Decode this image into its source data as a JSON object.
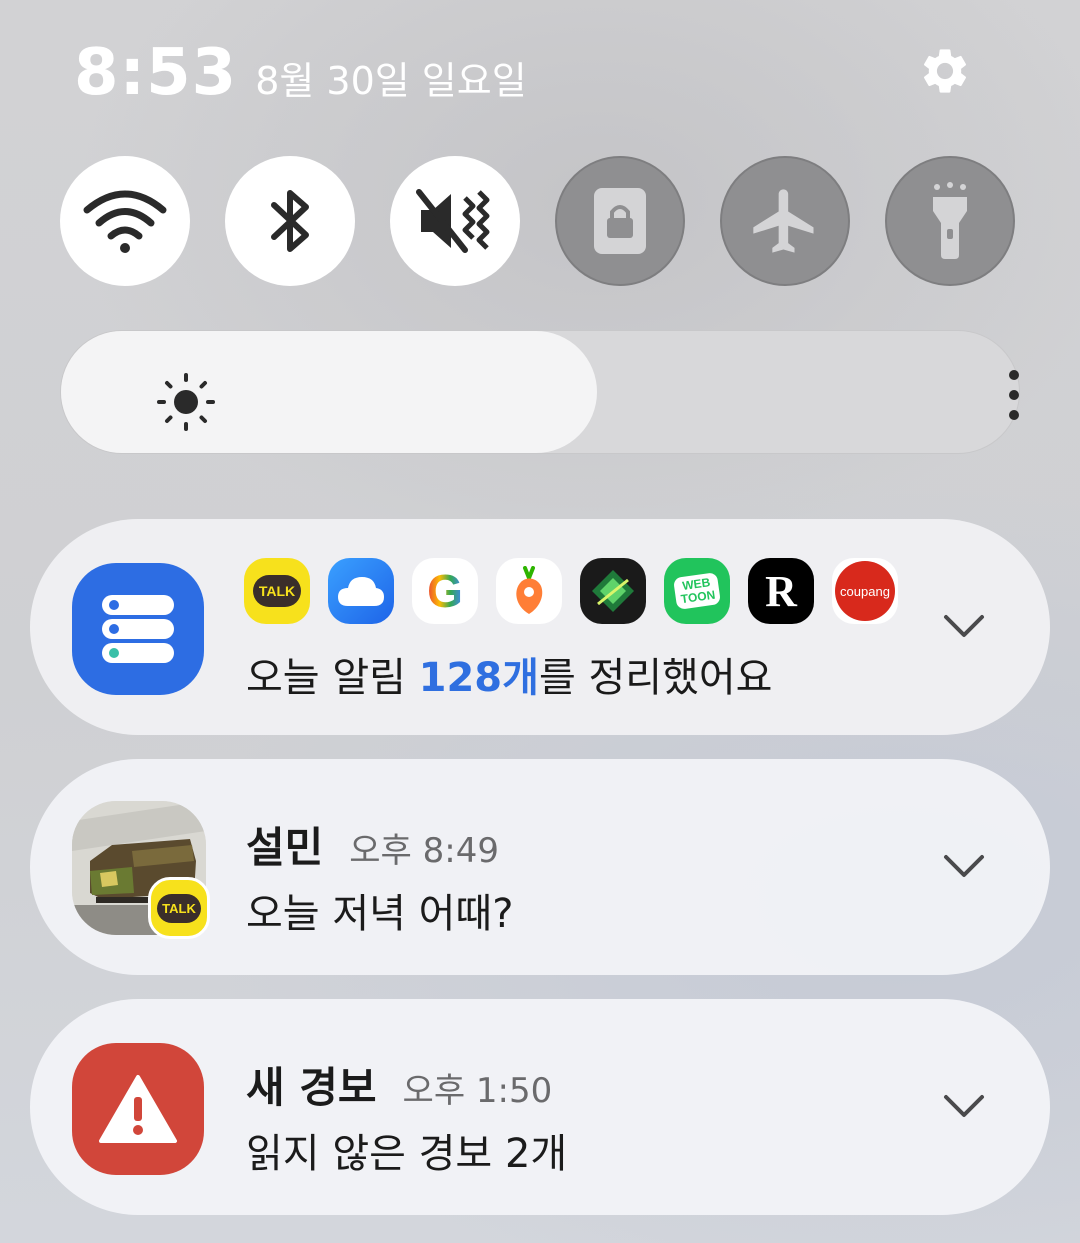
{
  "status": {
    "time": "8:53",
    "date": "8월 30일 일요일"
  },
  "toggles": [
    {
      "name": "wifi",
      "state": "on"
    },
    {
      "name": "bluetooth",
      "state": "on"
    },
    {
      "name": "vibrate",
      "state": "on"
    },
    {
      "name": "screen-lock",
      "state": "off"
    },
    {
      "name": "airplane-mode",
      "state": "off"
    },
    {
      "name": "flashlight",
      "state": "off"
    }
  ],
  "brightness": {
    "level_percent": 56
  },
  "notifications": {
    "summary": {
      "apps": [
        "kakaotalk",
        "weather",
        "google",
        "daangn",
        "game",
        "webtoon",
        "ridi",
        "coupang"
      ],
      "kakao_label": "TALK",
      "webtoon_label_1": "WEB",
      "webtoon_label_2": "TOON",
      "ridi_label": "R",
      "coupang_label": "coupang",
      "google_label": "G",
      "text_before": "오늘 알림 ",
      "count": "128개",
      "text_after": "를 정리했어요"
    },
    "kakao_message": {
      "sender": "설민",
      "time": "오후 8:49",
      "message": "오늘 저녁 어때?",
      "badge_label": "TALK"
    },
    "alert": {
      "title": "새 경보",
      "time": "오후 1:50",
      "message": "읽지 않은 경보 2개"
    }
  },
  "colors": {
    "accent": "#2f6fe0",
    "summary_app": "#2d6de3",
    "alert_app": "#d1463a",
    "kakao": "#f7e11c"
  }
}
